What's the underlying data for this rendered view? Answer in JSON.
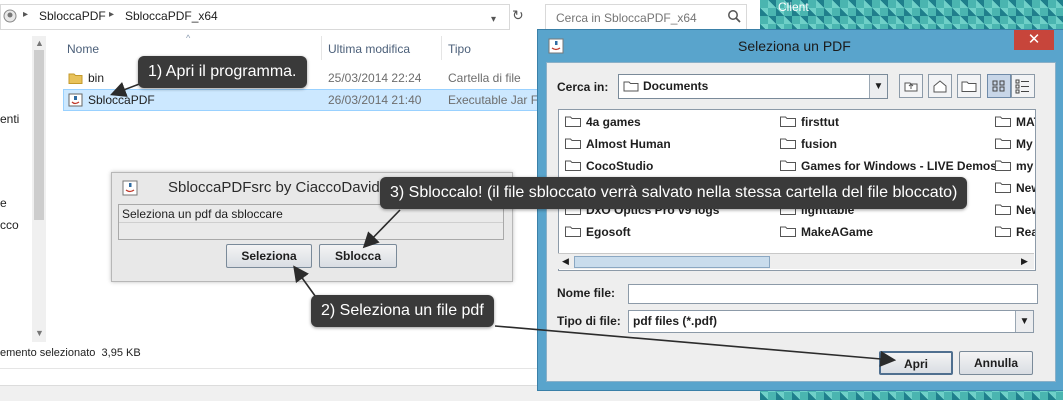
{
  "explorer": {
    "breadcrumb": [
      "SbloccaPDF",
      "SbloccaPDF_x64"
    ],
    "search_placeholder": "Cerca in SbloccaPDF_x64",
    "nav_fragments": [
      "enti",
      "e",
      "cco"
    ],
    "columns": [
      "Nome",
      "Ultima modifica",
      "Tipo"
    ],
    "files": [
      {
        "name": "bin",
        "date": "25/03/2014 22:24",
        "type": "Cartella di file",
        "icon": "folder-icon",
        "selected": false
      },
      {
        "name": "SbloccaPDF",
        "date": "26/03/2014 21:40",
        "type": "Executable Jar File",
        "icon": "jar-file-icon",
        "selected": true
      }
    ],
    "status_text": "emento selezionato",
    "status_size": "3,95 KB"
  },
  "desktop": {
    "label": "Client"
  },
  "java_window": {
    "title": "SbloccaPDFsrc by CiaccoDavide",
    "field_text": "Seleziona un pdf da sbloccare",
    "select_button": "Seleziona",
    "unlock_button": "Sblocca"
  },
  "dialog": {
    "title": "Seleziona un PDF",
    "close_label": "✕",
    "look_in_label": "Cerca in:",
    "look_in_value": "Documents",
    "files_col1": [
      "4a games",
      "Almost Human",
      "CocoStudio",
      "",
      "DxO Optics Pro v9 logs",
      "Egosoft"
    ],
    "files_col2": [
      "firsttut",
      "fusion",
      "Games for Windows - LIVE Demos",
      "",
      "lighttable",
      "MakeAGame"
    ],
    "files_col3": [
      "MAT",
      "My C",
      "my g",
      "New",
      "New",
      "Rea"
    ],
    "file_name_label": "Nome file:",
    "file_name_value": "",
    "file_type_label": "Tipo di file:",
    "file_type_value": "pdf files (*.pdf)",
    "open_button": "Apri",
    "cancel_button": "Annulla"
  },
  "callouts": {
    "step1": "1) Apri il programma.",
    "step2": "2) Seleziona un file pdf",
    "step3": "3) Sbloccalo! (il file sbloccato verrà salvato nella stessa cartella del file bloccato)"
  },
  "colors": {
    "dialog_frame": "#59a4cc",
    "close_button": "#c7453b",
    "callout_bg": "#3a3a3a",
    "selection": "#cce8ff"
  }
}
